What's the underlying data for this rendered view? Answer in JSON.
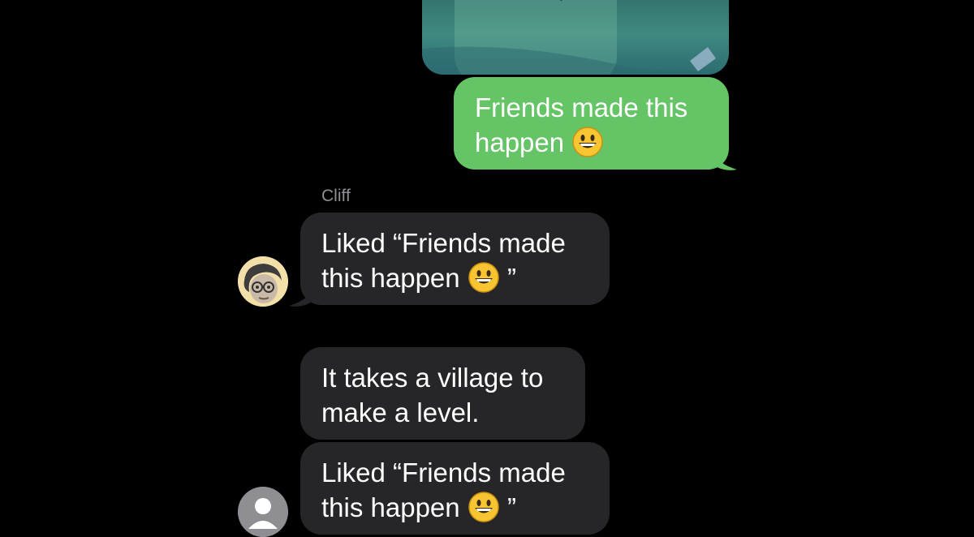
{
  "thread": {
    "sent_message": {
      "line1": "Friends made this",
      "line2": "happen"
    },
    "sender_name": "Cliff",
    "received_messages": [
      {
        "line1": "Liked “Friends made",
        "line2_text": "this happen",
        "line2_tail": "”"
      },
      {
        "line1": "It takes a village to",
        "line2": "make a level."
      },
      {
        "line1": "Liked “Friends made",
        "line2_text": "this happen",
        "line2_tail": "”"
      }
    ]
  },
  "icons": {
    "emoji": "grinning-face-emoji",
    "avatar_cliff": "cliff-avatar-icon",
    "avatar_generic": "person-avatar-icon"
  },
  "colors": {
    "background": "#000000",
    "sent_bubble": "#65c466",
    "received_bubble": "#262629",
    "sender_name": "#8e8e93"
  }
}
